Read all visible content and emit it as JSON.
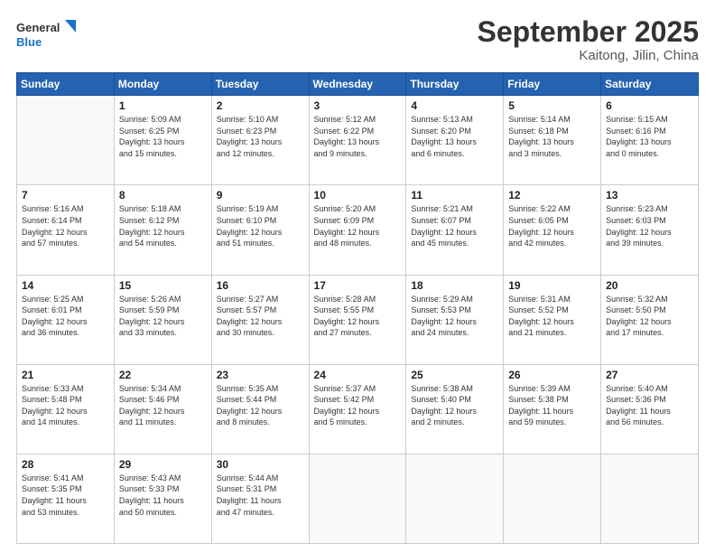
{
  "logo": {
    "line1": "General",
    "line2": "Blue"
  },
  "header": {
    "month": "September 2025",
    "location": "Kaitong, Jilin, China"
  },
  "days_of_week": [
    "Sunday",
    "Monday",
    "Tuesday",
    "Wednesday",
    "Thursday",
    "Friday",
    "Saturday"
  ],
  "weeks": [
    [
      {
        "day": "",
        "detail": ""
      },
      {
        "day": "1",
        "detail": "Sunrise: 5:09 AM\nSunset: 6:25 PM\nDaylight: 13 hours\nand 15 minutes."
      },
      {
        "day": "2",
        "detail": "Sunrise: 5:10 AM\nSunset: 6:23 PM\nDaylight: 13 hours\nand 12 minutes."
      },
      {
        "day": "3",
        "detail": "Sunrise: 5:12 AM\nSunset: 6:22 PM\nDaylight: 13 hours\nand 9 minutes."
      },
      {
        "day": "4",
        "detail": "Sunrise: 5:13 AM\nSunset: 6:20 PM\nDaylight: 13 hours\nand 6 minutes."
      },
      {
        "day": "5",
        "detail": "Sunrise: 5:14 AM\nSunset: 6:18 PM\nDaylight: 13 hours\nand 3 minutes."
      },
      {
        "day": "6",
        "detail": "Sunrise: 5:15 AM\nSunset: 6:16 PM\nDaylight: 13 hours\nand 0 minutes."
      }
    ],
    [
      {
        "day": "7",
        "detail": "Sunrise: 5:16 AM\nSunset: 6:14 PM\nDaylight: 12 hours\nand 57 minutes."
      },
      {
        "day": "8",
        "detail": "Sunrise: 5:18 AM\nSunset: 6:12 PM\nDaylight: 12 hours\nand 54 minutes."
      },
      {
        "day": "9",
        "detail": "Sunrise: 5:19 AM\nSunset: 6:10 PM\nDaylight: 12 hours\nand 51 minutes."
      },
      {
        "day": "10",
        "detail": "Sunrise: 5:20 AM\nSunset: 6:09 PM\nDaylight: 12 hours\nand 48 minutes."
      },
      {
        "day": "11",
        "detail": "Sunrise: 5:21 AM\nSunset: 6:07 PM\nDaylight: 12 hours\nand 45 minutes."
      },
      {
        "day": "12",
        "detail": "Sunrise: 5:22 AM\nSunset: 6:05 PM\nDaylight: 12 hours\nand 42 minutes."
      },
      {
        "day": "13",
        "detail": "Sunrise: 5:23 AM\nSunset: 6:03 PM\nDaylight: 12 hours\nand 39 minutes."
      }
    ],
    [
      {
        "day": "14",
        "detail": "Sunrise: 5:25 AM\nSunset: 6:01 PM\nDaylight: 12 hours\nand 36 minutes."
      },
      {
        "day": "15",
        "detail": "Sunrise: 5:26 AM\nSunset: 5:59 PM\nDaylight: 12 hours\nand 33 minutes."
      },
      {
        "day": "16",
        "detail": "Sunrise: 5:27 AM\nSunset: 5:57 PM\nDaylight: 12 hours\nand 30 minutes."
      },
      {
        "day": "17",
        "detail": "Sunrise: 5:28 AM\nSunset: 5:55 PM\nDaylight: 12 hours\nand 27 minutes."
      },
      {
        "day": "18",
        "detail": "Sunrise: 5:29 AM\nSunset: 5:53 PM\nDaylight: 12 hours\nand 24 minutes."
      },
      {
        "day": "19",
        "detail": "Sunrise: 5:31 AM\nSunset: 5:52 PM\nDaylight: 12 hours\nand 21 minutes."
      },
      {
        "day": "20",
        "detail": "Sunrise: 5:32 AM\nSunset: 5:50 PM\nDaylight: 12 hours\nand 17 minutes."
      }
    ],
    [
      {
        "day": "21",
        "detail": "Sunrise: 5:33 AM\nSunset: 5:48 PM\nDaylight: 12 hours\nand 14 minutes."
      },
      {
        "day": "22",
        "detail": "Sunrise: 5:34 AM\nSunset: 5:46 PM\nDaylight: 12 hours\nand 11 minutes."
      },
      {
        "day": "23",
        "detail": "Sunrise: 5:35 AM\nSunset: 5:44 PM\nDaylight: 12 hours\nand 8 minutes."
      },
      {
        "day": "24",
        "detail": "Sunrise: 5:37 AM\nSunset: 5:42 PM\nDaylight: 12 hours\nand 5 minutes."
      },
      {
        "day": "25",
        "detail": "Sunrise: 5:38 AM\nSunset: 5:40 PM\nDaylight: 12 hours\nand 2 minutes."
      },
      {
        "day": "26",
        "detail": "Sunrise: 5:39 AM\nSunset: 5:38 PM\nDaylight: 11 hours\nand 59 minutes."
      },
      {
        "day": "27",
        "detail": "Sunrise: 5:40 AM\nSunset: 5:36 PM\nDaylight: 11 hours\nand 56 minutes."
      }
    ],
    [
      {
        "day": "28",
        "detail": "Sunrise: 5:41 AM\nSunset: 5:35 PM\nDaylight: 11 hours\nand 53 minutes."
      },
      {
        "day": "29",
        "detail": "Sunrise: 5:43 AM\nSunset: 5:33 PM\nDaylight: 11 hours\nand 50 minutes."
      },
      {
        "day": "30",
        "detail": "Sunrise: 5:44 AM\nSunset: 5:31 PM\nDaylight: 11 hours\nand 47 minutes."
      },
      {
        "day": "",
        "detail": ""
      },
      {
        "day": "",
        "detail": ""
      },
      {
        "day": "",
        "detail": ""
      },
      {
        "day": "",
        "detail": ""
      }
    ]
  ]
}
